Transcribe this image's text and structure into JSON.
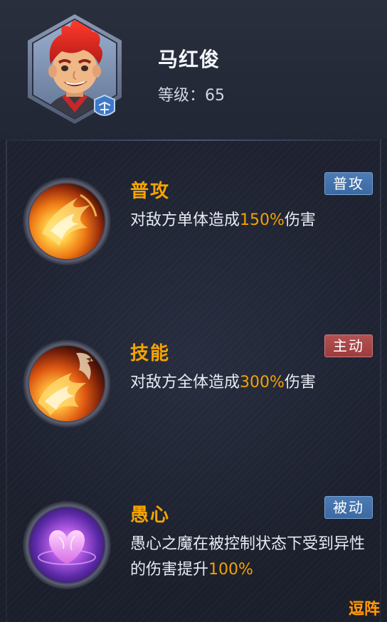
{
  "hero": {
    "name": "马红俊",
    "level_label": "等级：",
    "level_value": "65"
  },
  "skills": [
    {
      "name": "普攻",
      "tag": "普攻",
      "tag_color": "#3f6ea8",
      "icon": "fire-strike-icon",
      "desc_before": "对敌方单体造成",
      "desc_highlight": "150%",
      "desc_after": "伤害"
    },
    {
      "name": "技能",
      "tag": "主动",
      "tag_color": "#a84546",
      "icon": "phoenix-fire-icon",
      "desc_before": "对敌方全体造成",
      "desc_highlight": "300%",
      "desc_after": "伤害"
    },
    {
      "name": "愚心",
      "tag": "被动",
      "tag_color": "#3f6ea8",
      "icon": "purple-heart-icon",
      "desc_before": "愚心之魔在被控制状态下受到异性的伤害提升",
      "desc_highlight": "100%",
      "desc_after": ""
    }
  ],
  "watermark": "逗阵",
  "colors": {
    "accent_orange": "#f6a400",
    "highlight": "#f2a200",
    "panel_bg": "#1f2330"
  }
}
